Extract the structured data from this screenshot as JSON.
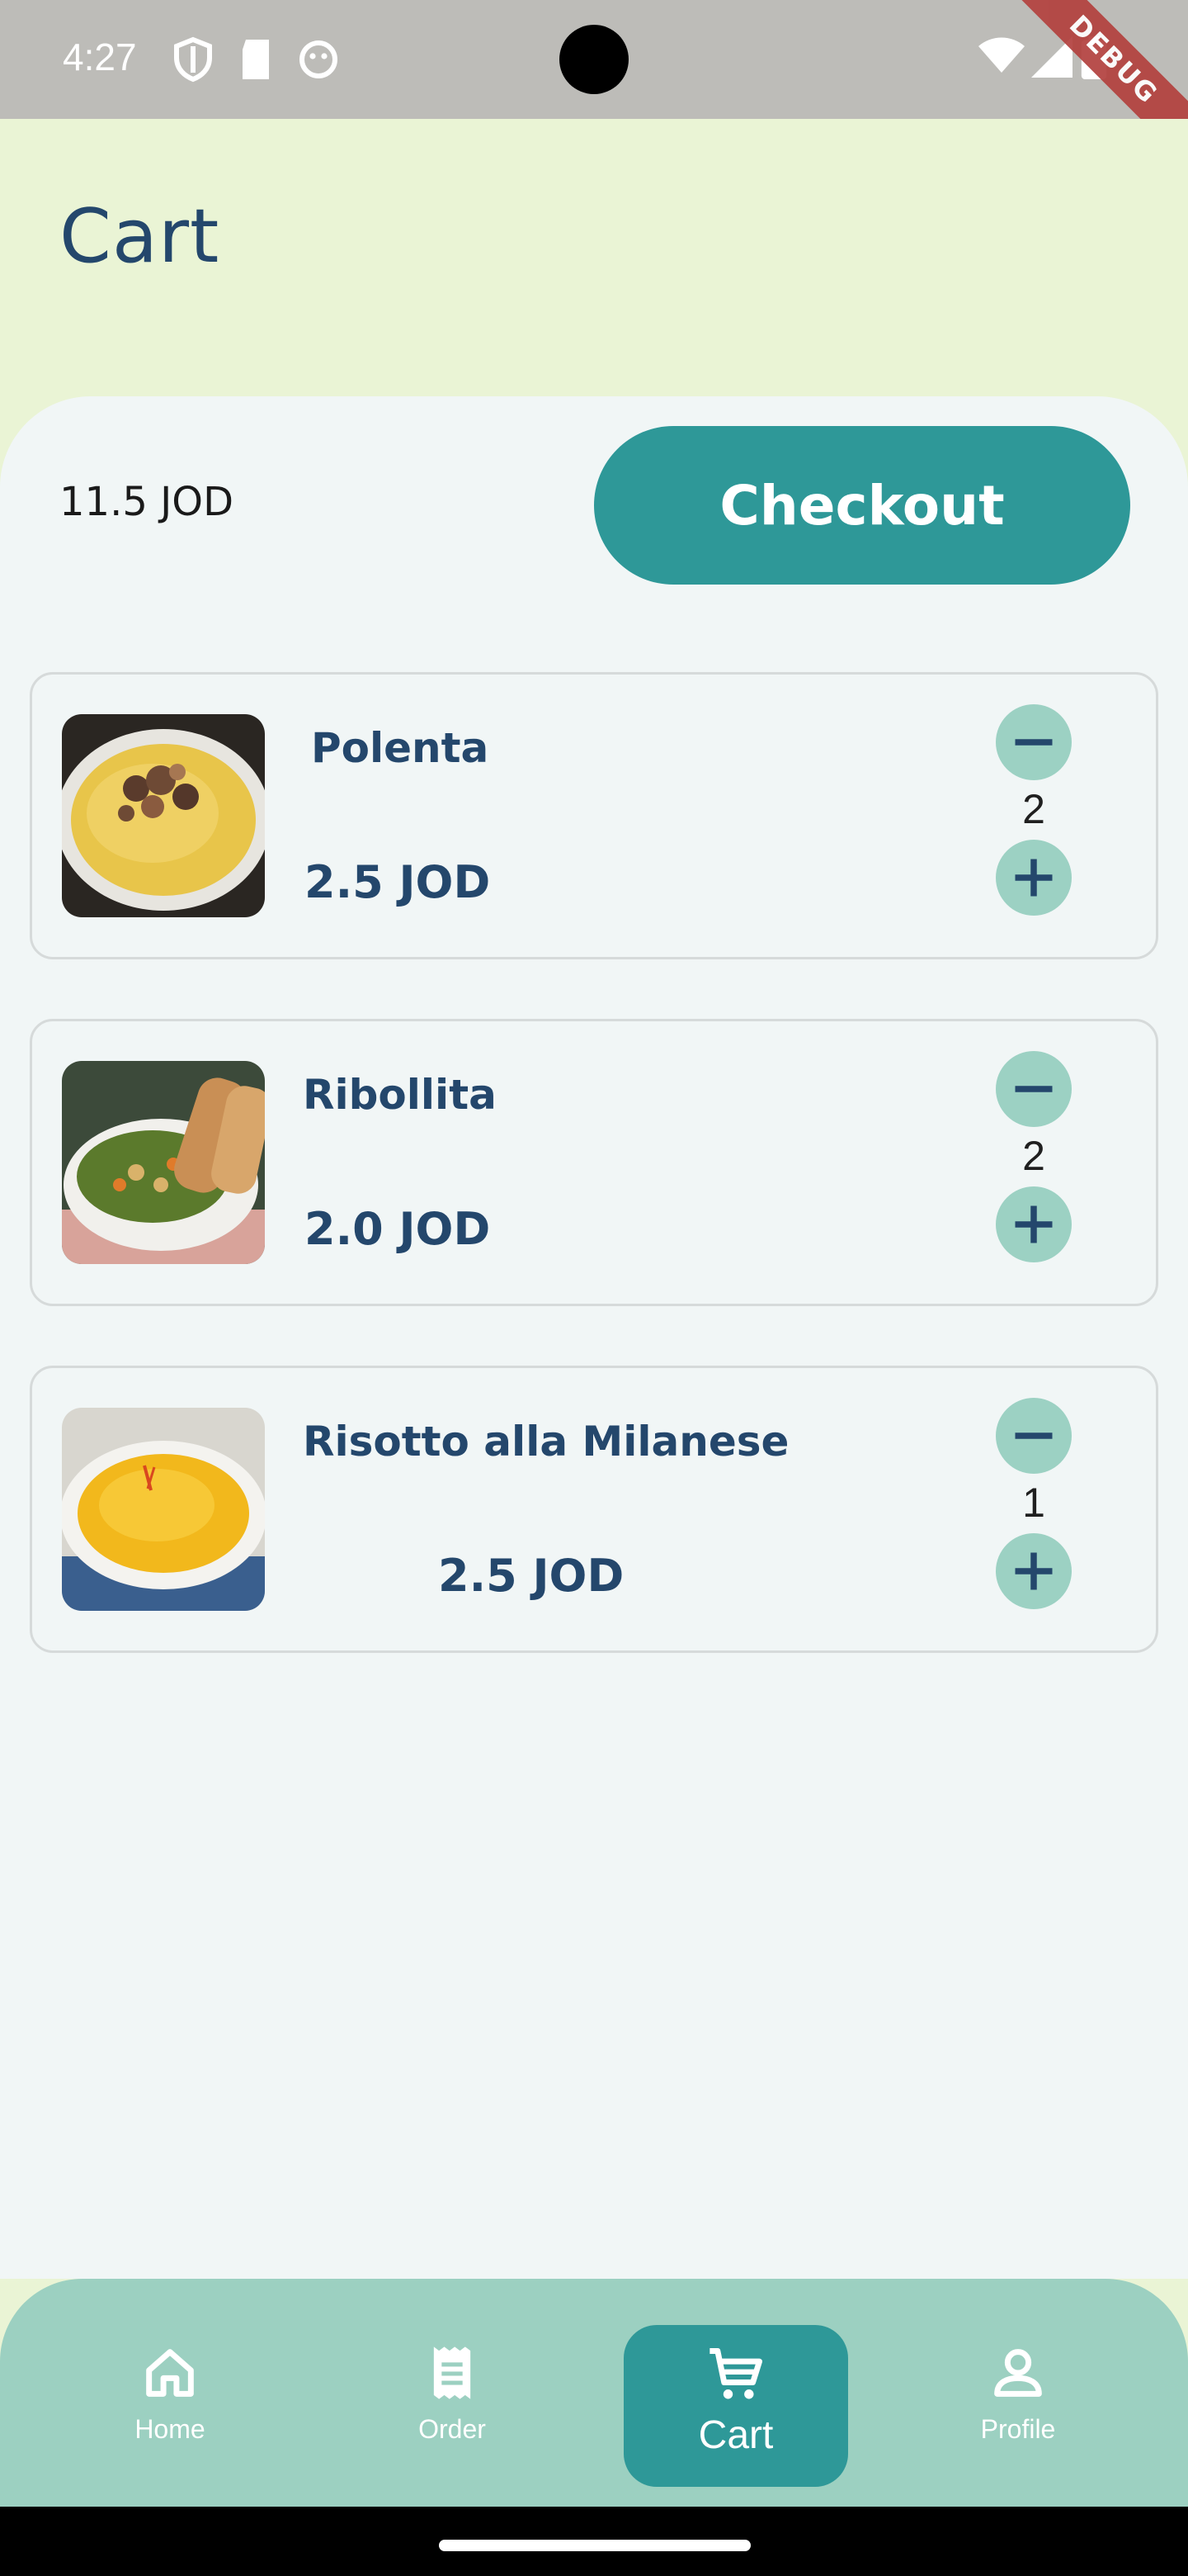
{
  "status_bar": {
    "time": "4:27",
    "debug_label": "DEBUG"
  },
  "header": {
    "title": "Cart"
  },
  "summary": {
    "total": "11.5 JOD",
    "checkout_label": "Checkout"
  },
  "cart_items": [
    {
      "name": "Polenta",
      "price": "2.5 JOD",
      "quantity": "2"
    },
    {
      "name": "Ribollita",
      "price": "2.0 JOD",
      "quantity": "2"
    },
    {
      "name": "Risotto alla Milanese",
      "price": "2.5 JOD",
      "quantity": "1"
    }
  ],
  "bottom_nav": {
    "items": [
      {
        "label": "Home",
        "icon": "home-icon"
      },
      {
        "label": "Order",
        "icon": "receipt-icon"
      },
      {
        "label": "Cart",
        "icon": "cart-icon",
        "active": true
      },
      {
        "label": "Profile",
        "icon": "profile-icon"
      }
    ]
  },
  "colors": {
    "accent": "#2e9898",
    "header_bg": "#eaf4d5",
    "text_primary": "#24476c",
    "nav_bg": "#9cd0c1",
    "qty_button": "#9cd1c3"
  }
}
